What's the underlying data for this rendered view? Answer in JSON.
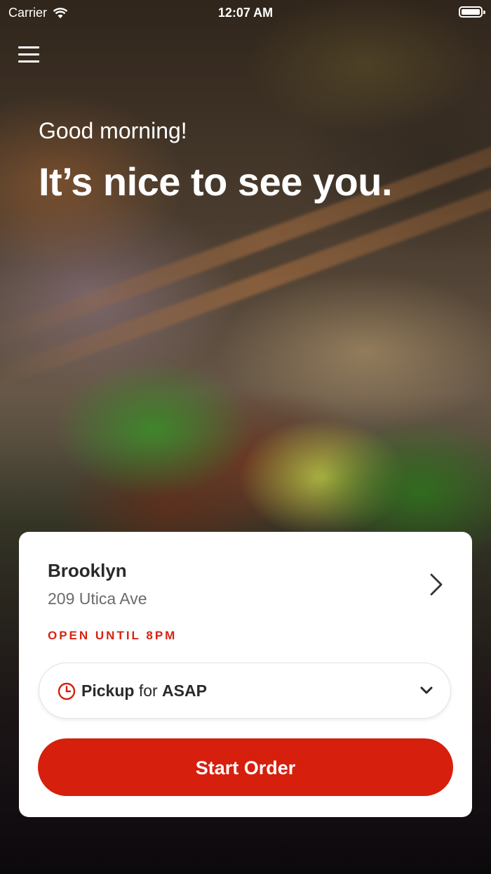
{
  "status_bar": {
    "carrier": "Carrier",
    "time": "12:07 AM"
  },
  "hero": {
    "greeting": "Good morning!",
    "headline": "It’s nice to see you."
  },
  "location": {
    "name": "Brooklyn",
    "address": "209 Utica Ave",
    "status": "OPEN UNTIL 8PM"
  },
  "order_type": {
    "mode": "Pickup",
    "connector": "for",
    "time": "ASAP"
  },
  "cta": {
    "start_order_label": "Start Order"
  },
  "colors": {
    "accent": "#d61f0d",
    "status_text": "#d62411"
  },
  "icons": [
    "menu-icon",
    "wifi-icon",
    "battery-icon",
    "chevron-right-icon",
    "clock-icon",
    "chevron-down-icon"
  ]
}
